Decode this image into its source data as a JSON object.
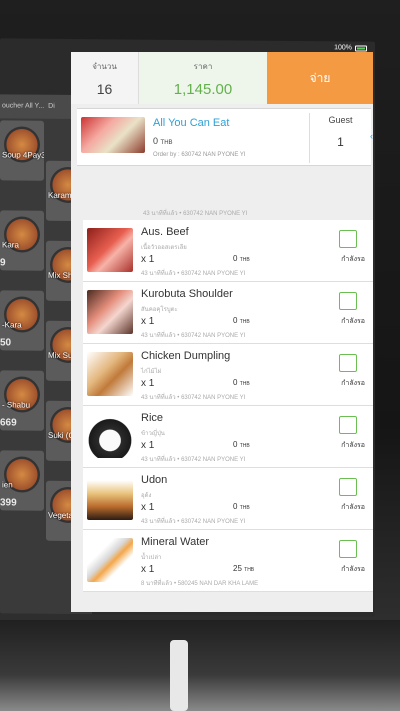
{
  "status": {
    "battery": "100%"
  },
  "toolbar": {
    "icons": [
      "search-icon",
      "scan-icon",
      "tag-icon",
      "lock-icon",
      "receipt-icon",
      "more-icon"
    ]
  },
  "menu": {
    "tabs": [
      "oucher All Y...",
      "Di"
    ],
    "tiles": [
      {
        "label": "Soup 4Pay3",
        "price": ""
      },
      {
        "label": "Karamis (Childre",
        "price": ""
      },
      {
        "label": "Kara",
        "price": "9"
      },
      {
        "label": "Mix Sha",
        "price": ""
      },
      {
        "label": "-Kara",
        "price": "50"
      },
      {
        "label": "Mix Suki (Childre",
        "price": ""
      },
      {
        "label": "- Shabu",
        "price": "669"
      },
      {
        "label": "Suki (C",
        "price": ""
      },
      {
        "label": "ien",
        "price": "399"
      },
      {
        "label": "Vegetar (Childre",
        "price": ""
      }
    ]
  },
  "summary": {
    "qty_label": "จำนวน",
    "qty_value": "16",
    "price_label": "ราคา",
    "price_value": "1,145.00",
    "pay_label": "จ่าย"
  },
  "ayce": {
    "name": "All You Can Eat",
    "price": "0",
    "currency": "THB",
    "order_by": "Order by : 630742  NAN PYONE  YI",
    "guest_label": "Guest",
    "guest_value": "1"
  },
  "trailing_meta": "43 นาทีที่แล้ว  •  630742  NAN PYONE  YI",
  "items": [
    {
      "name": "Aus. Beef",
      "sub": "เนื้อวัวออสเตรเลีย",
      "qty": "x 1",
      "price": "0",
      "currency": "THB",
      "meta": "43 นาทีที่แล้ว  •  630742  NAN PYONE  YI",
      "status": "กำลังรอ",
      "color": "#d9443a"
    },
    {
      "name": "Kurobuta Shoulder",
      "sub": "สันคอคุโรบูตะ",
      "qty": "x 1",
      "price": "0",
      "currency": "THB",
      "meta": "43 นาทีที่แล้ว  •  630742  NAN PYONE  YI",
      "status": "กำลังรอ",
      "color": "#e58e7c"
    },
    {
      "name": "Chicken Dumpling",
      "sub": "ไก่ไม้ไผ่",
      "qty": "x 1",
      "price": "0",
      "currency": "THB",
      "meta": "43 นาทีที่แล้ว  •  630742  NAN PYONE  YI",
      "status": "กำลังรอ",
      "color": "#e3b77e"
    },
    {
      "name": "Rice",
      "sub": "ข้าวญี่ปุ่น",
      "qty": "x 1",
      "price": "0",
      "currency": "THB",
      "meta": "43 นาทีที่แล้ว  •  630742  NAN PYONE  YI",
      "status": "กำลังรอ",
      "color": "#f2f2f2"
    },
    {
      "name": "Udon",
      "sub": "อุด้ง",
      "qty": "x 1",
      "price": "0",
      "currency": "THB",
      "meta": "43 นาทีที่แล้ว  •  630742  NAN PYONE  YI",
      "status": "กำลังรอ",
      "color": "#e9c37c"
    },
    {
      "name": "Mineral Water",
      "sub": "น้ำเปล่า",
      "qty": "x 1",
      "price": "25",
      "currency": "THB",
      "meta": "8 นาทีที่แล้ว  •  580245  NAN DAR KHA LAME",
      "status": "กำลังรอ",
      "color": "#d8d8d8"
    }
  ]
}
